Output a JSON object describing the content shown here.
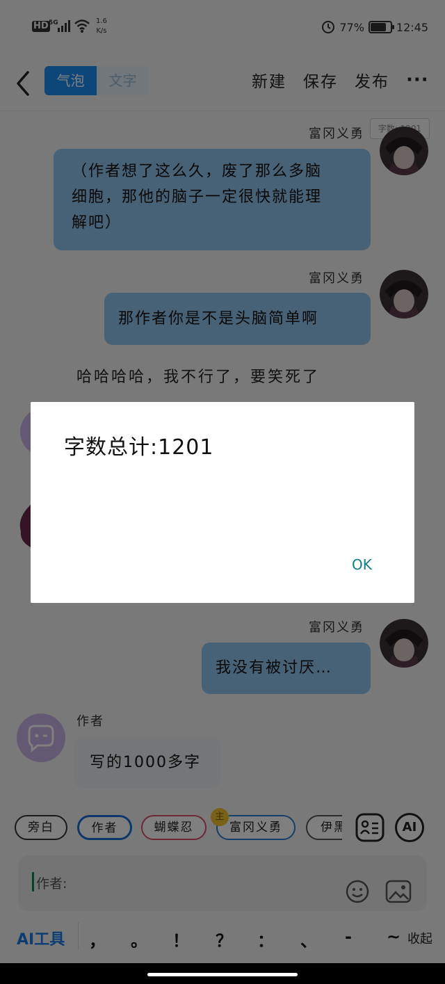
{
  "status_bar": {
    "hd": "HD",
    "network": "5G",
    "speed_value": "1.6",
    "speed_unit": "K/s",
    "battery": "77%",
    "battery_level": 0.77,
    "time": "12:45"
  },
  "header": {
    "mode_bubble": "气泡",
    "mode_text": "文字",
    "new_label": "新建",
    "save_label": "保存",
    "publish_label": "发布",
    "more_label": "···"
  },
  "word_count_badge": "字数: 1201",
  "messages": [
    {
      "sender": "富冈义勇",
      "lines": [
        "（作者想了这么久，废了那么多脑",
        "细胞，那他的脑子一定很快就能理",
        "解吧）"
      ]
    },
    {
      "sender": "富冈义勇",
      "text": "那作者你是不是头脑简单啊"
    },
    {
      "narration": "哈哈哈哈，我不行了，要笑死了"
    },
    {
      "sender": "富冈义勇",
      "text": "我没有被讨厌…"
    },
    {
      "sender": "作者",
      "text": "写的1000多字"
    }
  ],
  "role_chips": [
    {
      "label": "旁白",
      "color": "#333333"
    },
    {
      "label": "作者",
      "color": "#1a6fd0"
    },
    {
      "label": "蝴蝶忍",
      "color": "#d9506a"
    },
    {
      "label": "富冈义勇",
      "color": "#2a7fd0",
      "badge": "主"
    },
    {
      "label": "伊黑",
      "color": "#555555"
    }
  ],
  "ai_button": "AI",
  "input": {
    "prefix": "作者:"
  },
  "toolbar": {
    "ai_tool": "AI工具",
    "punctuation": [
      "，",
      "。",
      "！",
      "？",
      "：",
      "、",
      "-",
      "~"
    ],
    "collapse": "收起"
  },
  "dialog": {
    "title": "字数总计:1201",
    "ok": "OK"
  }
}
